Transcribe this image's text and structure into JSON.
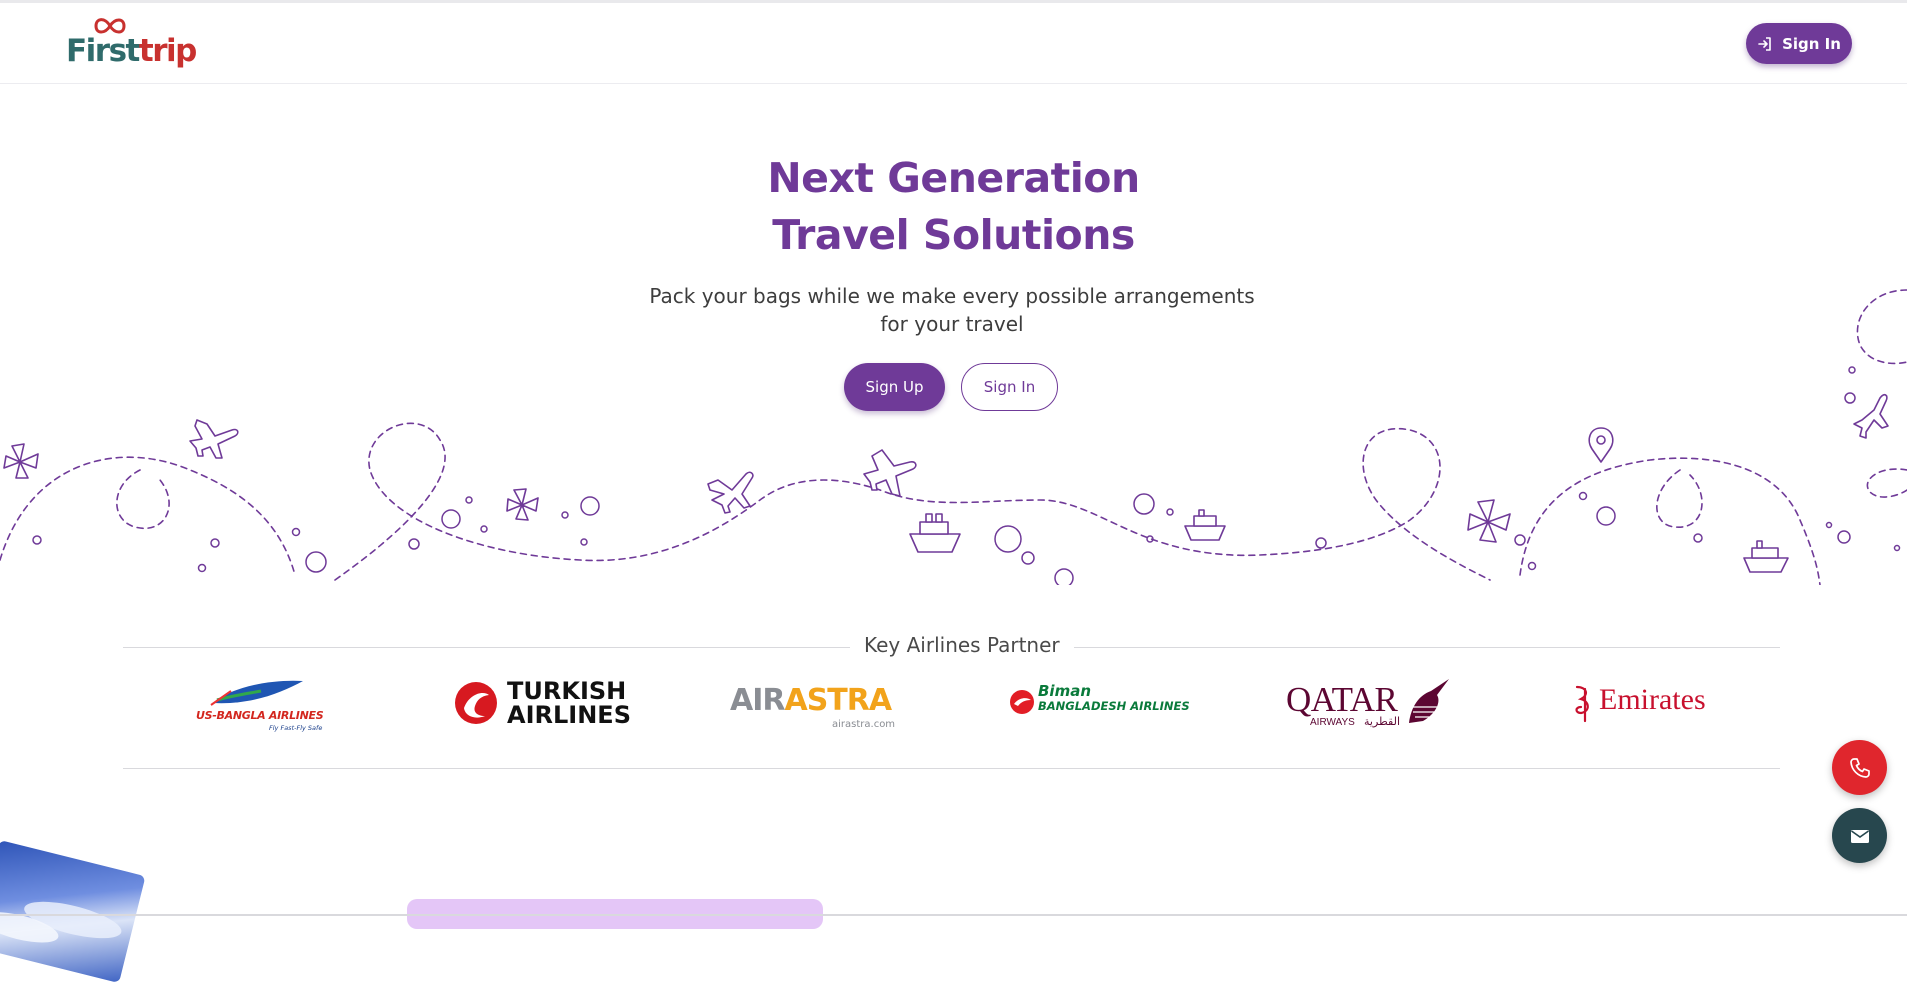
{
  "header": {
    "logo_text_a": "First",
    "logo_text_b": "trip",
    "signin_label": "Sign In"
  },
  "hero": {
    "title_line1": "Next Generation",
    "title_line2": "Travel Solutions",
    "subtitle": "Pack your bags while we make every possible arrangements for your travel",
    "signup_label": "Sign Up",
    "signin_label": "Sign In"
  },
  "partners": {
    "title": "Key Airlines Partner",
    "airlines": [
      {
        "name": "US-BANGLA AIRLINES",
        "tagline": "Fly Fast-Fly Safe"
      },
      {
        "name_line1": "TURKISH",
        "name_line2": "AIRLINES"
      },
      {
        "name_a": "AIR",
        "name_b": "ASTRA",
        "url": "airastra.com"
      },
      {
        "name_line1": "Biman",
        "name_line2": "BANGLADESH AIRLINES"
      },
      {
        "name": "QATAR",
        "sub": "AIRWAYS",
        "sub_ar": "القطرية"
      },
      {
        "name": "Emirates"
      }
    ]
  },
  "colors": {
    "brand_purple": "#6f3a98",
    "logo_teal": "#2f6b6b",
    "logo_red": "#c8312f",
    "phone_red": "#e0262d",
    "mail_dark": "#27474e"
  },
  "icons": {
    "nav_signin": "login-arrow-icon",
    "phone": "phone-icon",
    "mail": "mail-icon"
  }
}
